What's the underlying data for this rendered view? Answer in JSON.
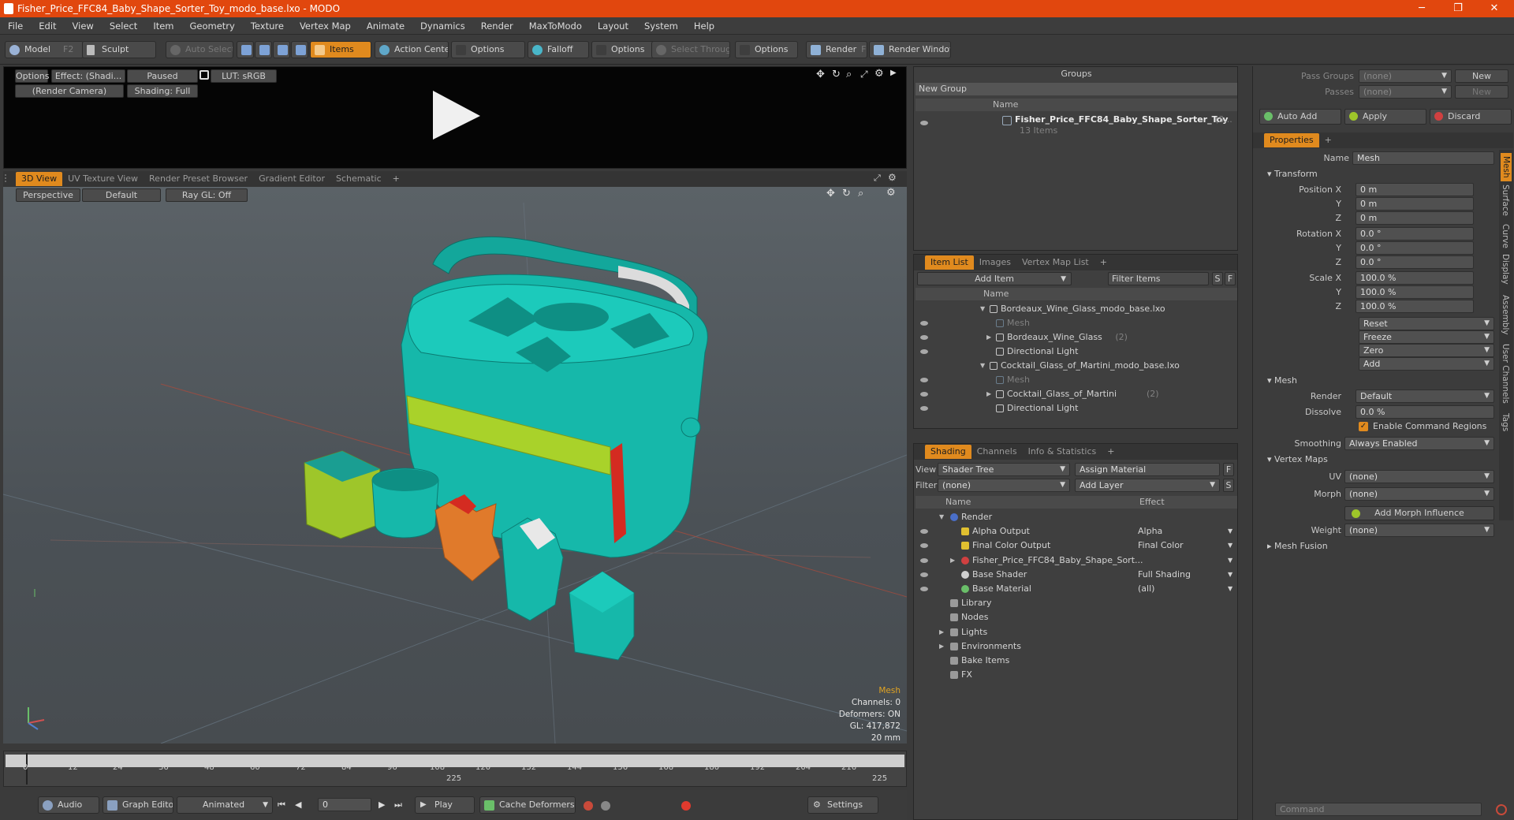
{
  "window": {
    "title": "Fisher_Price_FFC84_Baby_Shape_Sorter_Toy_modo_base.lxo - MODO",
    "minimize": "─",
    "maximize": "❐",
    "close": "✕"
  },
  "menu": [
    "File",
    "Edit",
    "View",
    "Select",
    "Item",
    "Geometry",
    "Texture",
    "Vertex Map",
    "Animate",
    "Dynamics",
    "Render",
    "MaxToModo",
    "Layout",
    "System",
    "Help"
  ],
  "toolbar": {
    "model": "Model",
    "model_key": "F2",
    "sculpt": "Sculpt",
    "auto_select": "Auto Select",
    "items": "Items",
    "action_center": "Action Center",
    "options1": "Options",
    "falloff": "Falloff",
    "options2": "Options",
    "select_through": "Select Through",
    "options3": "Options",
    "render": "Render",
    "render_key": "F9",
    "render_window": "Render Window"
  },
  "preview": {
    "options": "Options",
    "effect": "Effect: (Shadi...",
    "paused": "Paused",
    "lut": "LUT: sRGB",
    "camera": "(Render Camera)",
    "shading": "Shading: Full"
  },
  "viewport_tabs": [
    "3D View",
    "UV Texture View",
    "Render Preset Browser",
    "Gradient Editor",
    "Schematic",
    "+"
  ],
  "viewport": {
    "perspective": "Perspective",
    "default": "Default",
    "raygl": "Ray GL: Off",
    "info": {
      "mesh": "Mesh",
      "channels": "Channels: 0",
      "deformers": "Deformers: ON",
      "gl": "GL: 417,872",
      "scale": "20 mm"
    }
  },
  "timeline": {
    "ticks": [
      "0",
      "12",
      "24",
      "36",
      "48",
      "60",
      "72",
      "84",
      "96",
      "108",
      "120",
      "132",
      "144",
      "156",
      "168",
      "180",
      "192",
      "204",
      "216"
    ],
    "sub_ticks": [
      "225",
      "225"
    ]
  },
  "bottombar": {
    "audio": "Audio",
    "graph_editor": "Graph Editor",
    "animated": "Animated",
    "frame": "0",
    "play": "Play",
    "cache": "Cache Deformers",
    "settings": "Settings"
  },
  "groups": {
    "header": "Groups",
    "new_group": "New Group",
    "col_name": "Name",
    "item_name": "Fisher_Price_FFC84_Baby_Shape_Sorter_Toy",
    "item_count": "(3...",
    "item_sub": "13 Items"
  },
  "itemlist": {
    "tabs": [
      "Item List",
      "Images",
      "Vertex Map List",
      "+"
    ],
    "add_item": "Add Item",
    "filter_items": "Filter Items",
    "s": "S",
    "f": "F",
    "col_name": "Name",
    "rows": [
      {
        "label": "Bordeaux_Wine_Glass_modo_base.lxo",
        "count": "",
        "indent": 0,
        "dim": false,
        "expand": "▼"
      },
      {
        "label": "Mesh",
        "count": "",
        "indent": 1,
        "dim": true,
        "expand": ""
      },
      {
        "label": "Bordeaux_Wine_Glass",
        "count": "(2)",
        "indent": 1,
        "dim": false,
        "expand": "▶"
      },
      {
        "label": "Directional Light",
        "count": "",
        "indent": 1,
        "dim": false,
        "expand": ""
      },
      {
        "label": "Cocktail_Glass_of_Martini_modo_base.lxo",
        "count": "",
        "indent": 0,
        "dim": false,
        "expand": "▼"
      },
      {
        "label": "Mesh",
        "count": "",
        "indent": 1,
        "dim": true,
        "expand": ""
      },
      {
        "label": "Cocktail_Glass_of_Martini",
        "count": "(2)",
        "indent": 1,
        "dim": false,
        "expand": "▶"
      },
      {
        "label": "Directional Light",
        "count": "",
        "indent": 1,
        "dim": false,
        "expand": ""
      }
    ]
  },
  "shading": {
    "tabs": [
      "Shading",
      "Channels",
      "Info & Statistics",
      "+"
    ],
    "view_label": "View",
    "view_value": "Shader Tree",
    "assign_material": "Assign Material",
    "f": "F",
    "filter_label": "Filter",
    "filter_value": "(none)",
    "add_layer": "Add Layer",
    "s": "S",
    "col_name": "Name",
    "col_effect": "Effect",
    "rows": [
      {
        "label": "Render",
        "effect": "",
        "indent": 0,
        "expand": "▼",
        "eye": false
      },
      {
        "label": "Alpha Output",
        "effect": "Alpha",
        "indent": 1,
        "expand": "",
        "eye": true
      },
      {
        "label": "Final Color Output",
        "effect": "Final Color",
        "indent": 1,
        "expand": "",
        "eye": true
      },
      {
        "label": "Fisher_Price_FFC84_Baby_Shape_Sort...",
        "effect": "",
        "indent": 1,
        "expand": "▶",
        "eye": true
      },
      {
        "label": "Base Shader",
        "effect": "Full Shading",
        "indent": 1,
        "expand": "",
        "eye": true
      },
      {
        "label": "Base Material",
        "effect": "(all)",
        "indent": 1,
        "expand": "",
        "eye": true
      },
      {
        "label": "Library",
        "effect": "",
        "indent": 0,
        "expand": "",
        "eye": false
      },
      {
        "label": "Nodes",
        "effect": "",
        "indent": 0,
        "expand": "",
        "eye": false
      },
      {
        "label": "Lights",
        "effect": "",
        "indent": 0,
        "expand": "▶",
        "eye": false
      },
      {
        "label": "Environments",
        "effect": "",
        "indent": 0,
        "expand": "▶",
        "eye": false
      },
      {
        "label": "Bake Items",
        "effect": "",
        "indent": 0,
        "expand": "",
        "eye": false
      },
      {
        "label": "FX",
        "effect": "",
        "indent": 0,
        "expand": "",
        "eye": false
      }
    ]
  },
  "right": {
    "pass_groups_label": "Pass Groups",
    "pass_groups_value": "(none)",
    "new": "New",
    "passes_label": "Passes",
    "passes_value": "(none)",
    "new2": "New",
    "auto_add": "Auto Add",
    "apply": "Apply",
    "discard": "Discard",
    "properties_tab": "Properties",
    "plus": "+",
    "name_label": "Name",
    "name_value": "Mesh",
    "transform": "Transform",
    "pos_x_label": "Position X",
    "pos_x": "0 m",
    "pos_y": "0 m",
    "pos_z": "0 m",
    "rot_x_label": "Rotation X",
    "rot_x": "0.0 °",
    "rot_y": "0.0 °",
    "rot_z": "0.0 °",
    "scale_x_label": "Scale X",
    "scale_x": "100.0 %",
    "scale_y": "100.0 %",
    "scale_z": "100.0 %",
    "y": "Y",
    "z": "Z",
    "reset": "Reset",
    "freeze": "Freeze",
    "zero": "Zero",
    "add": "Add",
    "mesh_section": "Mesh",
    "render_label": "Render",
    "render_value": "Default",
    "dissolve_label": "Dissolve",
    "dissolve_value": "0.0 %",
    "enable_cmd": "Enable Command Regions",
    "smoothing_label": "Smoothing",
    "smoothing_value": "Always Enabled",
    "vertex_maps": "Vertex Maps",
    "uv_label": "UV",
    "uv_value": "(none)",
    "morph_label": "Morph",
    "morph_value": "(none)",
    "add_morph": "Add Morph Influence",
    "weight_label": "Weight",
    "weight_value": "(none)",
    "mesh_fusion": "Mesh Fusion",
    "side_tabs": [
      "Mesh",
      "Surface",
      "Curve",
      "Display",
      "Assembly",
      "User Channels",
      "Tags"
    ],
    "command": "Command"
  },
  "colors": {
    "accent": "#e08a1e",
    "titlebar": "#e1470e",
    "teal": "#12b5a8",
    "lime": "#9ec62a",
    "red": "#d42b21",
    "orange": "#e07a2b"
  }
}
